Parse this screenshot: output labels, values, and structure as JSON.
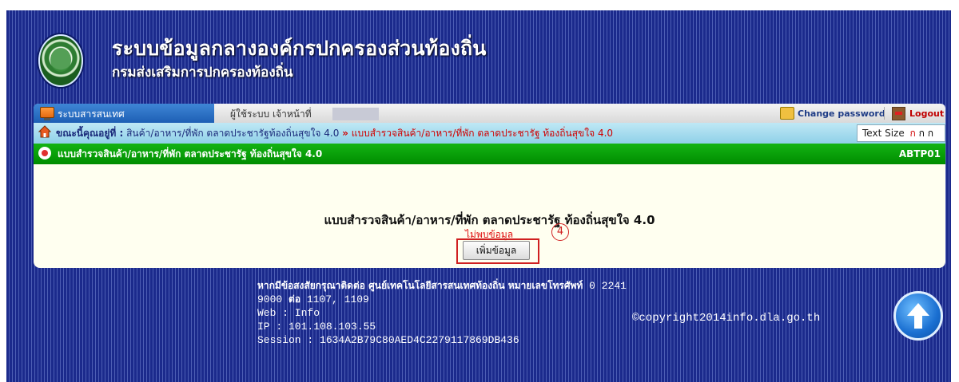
{
  "header": {
    "title": "ระบบข้อมูลกลางองค์กรปกครองส่วนท้องถิ่น",
    "subtitle": "กรมส่งเสริมการปกครองท้องถิ่น"
  },
  "tabbar": {
    "active_tab": "ระบบสารสนเทศ",
    "user_label": "ผู้ใช้ระบบ เจ้าหน้าที่",
    "change_password": "Change password",
    "logout": "Logout"
  },
  "breadcrumb": {
    "label": "ขณะนี้คุณอยู่ที่ :",
    "parent": "สินค้า/อาหาร/ที่พัก ตลาดประชารัฐท้องถิ่นสุขใจ 4.0",
    "separator": "»",
    "current": "แบบสำรวจสินค้า/อาหาร/ที่พัก ตลาดประชารัฐ ท้องถิ่นสุขใจ 4.0"
  },
  "text_size": {
    "label": "Text Size",
    "options": [
      "ก",
      "ก",
      "ก"
    ]
  },
  "section": {
    "title": "แบบสำรวจสินค้า/อาหาร/ที่พัก ตลาดประชารัฐ ท้องถิ่นสุขใจ 4.0",
    "code": "ABTP01"
  },
  "content": {
    "form_title": "แบบสำรวจสินค้า/อาหาร/ที่พัก ตลาดประชารัฐ ท้องถิ่นสุขใจ 4.0",
    "no_data": "ไม่พบข้อมูล",
    "annotation_number": "4",
    "add_button": "เพิ่มข้อมูล"
  },
  "footer": {
    "contact_text": "หากมีข้อสงสัยกรุณาติดต่อ ศูนย์เทคโนโลยีสารสนเทศท้องถิ่น หมายเลขโทรศัพท์",
    "phone_part1": "0 2241",
    "phone_part2": "9000",
    "ext_label": "ต่อ",
    "ext_numbers": "1107, 1109",
    "web_line": "Web : Info",
    "ip_line": "IP : 101.108.103.55",
    "session_line": "Session : 1634A2B79C80AED4C2279117869DB436",
    "copyright": "©copyright2014info.dla.go.th"
  },
  "colors": {
    "frame_bg": "#1b2a8c",
    "tab_active": "#1d5fb4",
    "breadcrumb_bg": "#8fd0e8",
    "green_bar": "#008d00",
    "panel_bg": "#fffff0",
    "alert_red": "#d00000"
  },
  "icons": {
    "logo": "dla-seal-logo",
    "tab": "monitor-icon",
    "change_password": "key-icon",
    "logout": "exit-door-icon",
    "home": "home-icon",
    "section": "red-dot-icon",
    "scroll_top": "arrow-up-icon"
  }
}
